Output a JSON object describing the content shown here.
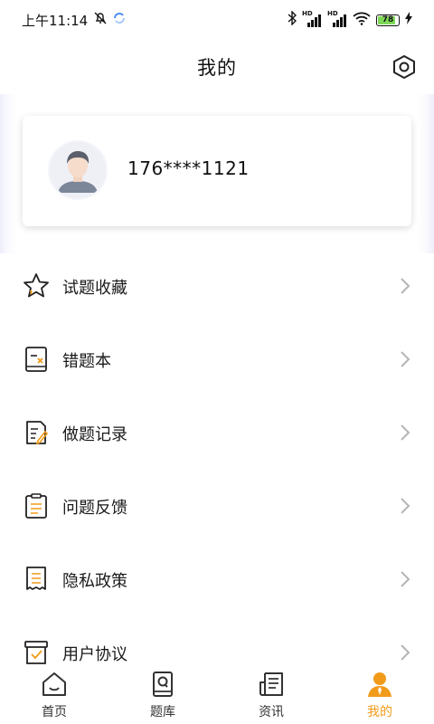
{
  "status_bar": {
    "time": "上午11:14",
    "battery": "78",
    "network_badges": [
      "HD",
      "HD"
    ]
  },
  "header": {
    "title": "我的"
  },
  "profile": {
    "phone": "176****1121"
  },
  "menu": {
    "items": [
      {
        "label": "试题收藏",
        "icon": "star-icon"
      },
      {
        "label": "错题本",
        "icon": "wrong-book-icon"
      },
      {
        "label": "做题记录",
        "icon": "record-icon"
      },
      {
        "label": "问题反馈",
        "icon": "feedback-icon"
      },
      {
        "label": "隐私政策",
        "icon": "privacy-icon"
      },
      {
        "label": "用户协议",
        "icon": "agreement-icon"
      }
    ]
  },
  "tabbar": {
    "tabs": [
      {
        "label": "首页",
        "icon": "home-icon"
      },
      {
        "label": "题库",
        "icon": "question-bank-icon"
      },
      {
        "label": "资讯",
        "icon": "news-icon"
      },
      {
        "label": "我的",
        "icon": "profile-icon"
      }
    ],
    "active_index": 3
  },
  "colors": {
    "accent": "#f29b1a",
    "text": "#1a1a1a",
    "chevron": "#b5b5b5"
  }
}
